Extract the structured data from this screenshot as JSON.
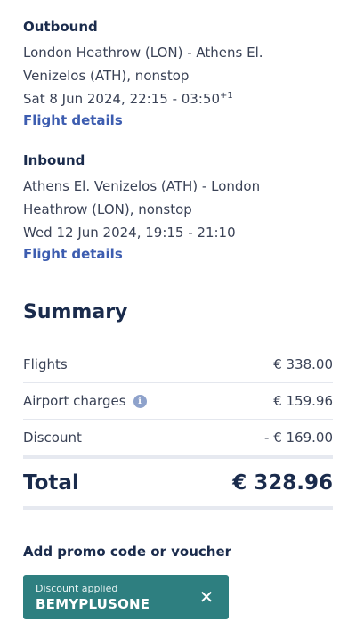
{
  "outbound": {
    "title": "Outbound",
    "route_line1": "London Heathrow (LON) - Athens El.",
    "route_line2": "Venizelos (ATH), nonstop",
    "datetime": "Sat 8 Jun 2024, 22:15 - 03:50",
    "day_offset": "+1",
    "details_link": "Flight details"
  },
  "inbound": {
    "title": "Inbound",
    "route_line1": "Athens El. Venizelos (ATH) - London",
    "route_line2": "Heathrow (LON), nonstop",
    "datetime": "Wed 12 Jun 2024, 19:15 - 21:10",
    "details_link": "Flight details"
  },
  "summary": {
    "title": "Summary",
    "rows": [
      {
        "label": "Flights",
        "value": "€ 338.00"
      },
      {
        "label": "Airport charges",
        "value": "€ 159.96",
        "icon": "info-icon"
      },
      {
        "label": "Discount",
        "value": "- € 169.00"
      }
    ],
    "total_label": "Total",
    "total_value": "€ 328.96"
  },
  "promo": {
    "label": "Add promo code or voucher",
    "status": "Discount applied",
    "code": "BEMYPLUSONE",
    "close_icon": "close-icon"
  },
  "colors": {
    "heading": "#1a2b4c",
    "text": "#3a4256",
    "link": "#3d5db0",
    "voucher_bg": "#2e7f80",
    "info_icon": "#8ea2cb",
    "separator": "#e6e9f0"
  }
}
